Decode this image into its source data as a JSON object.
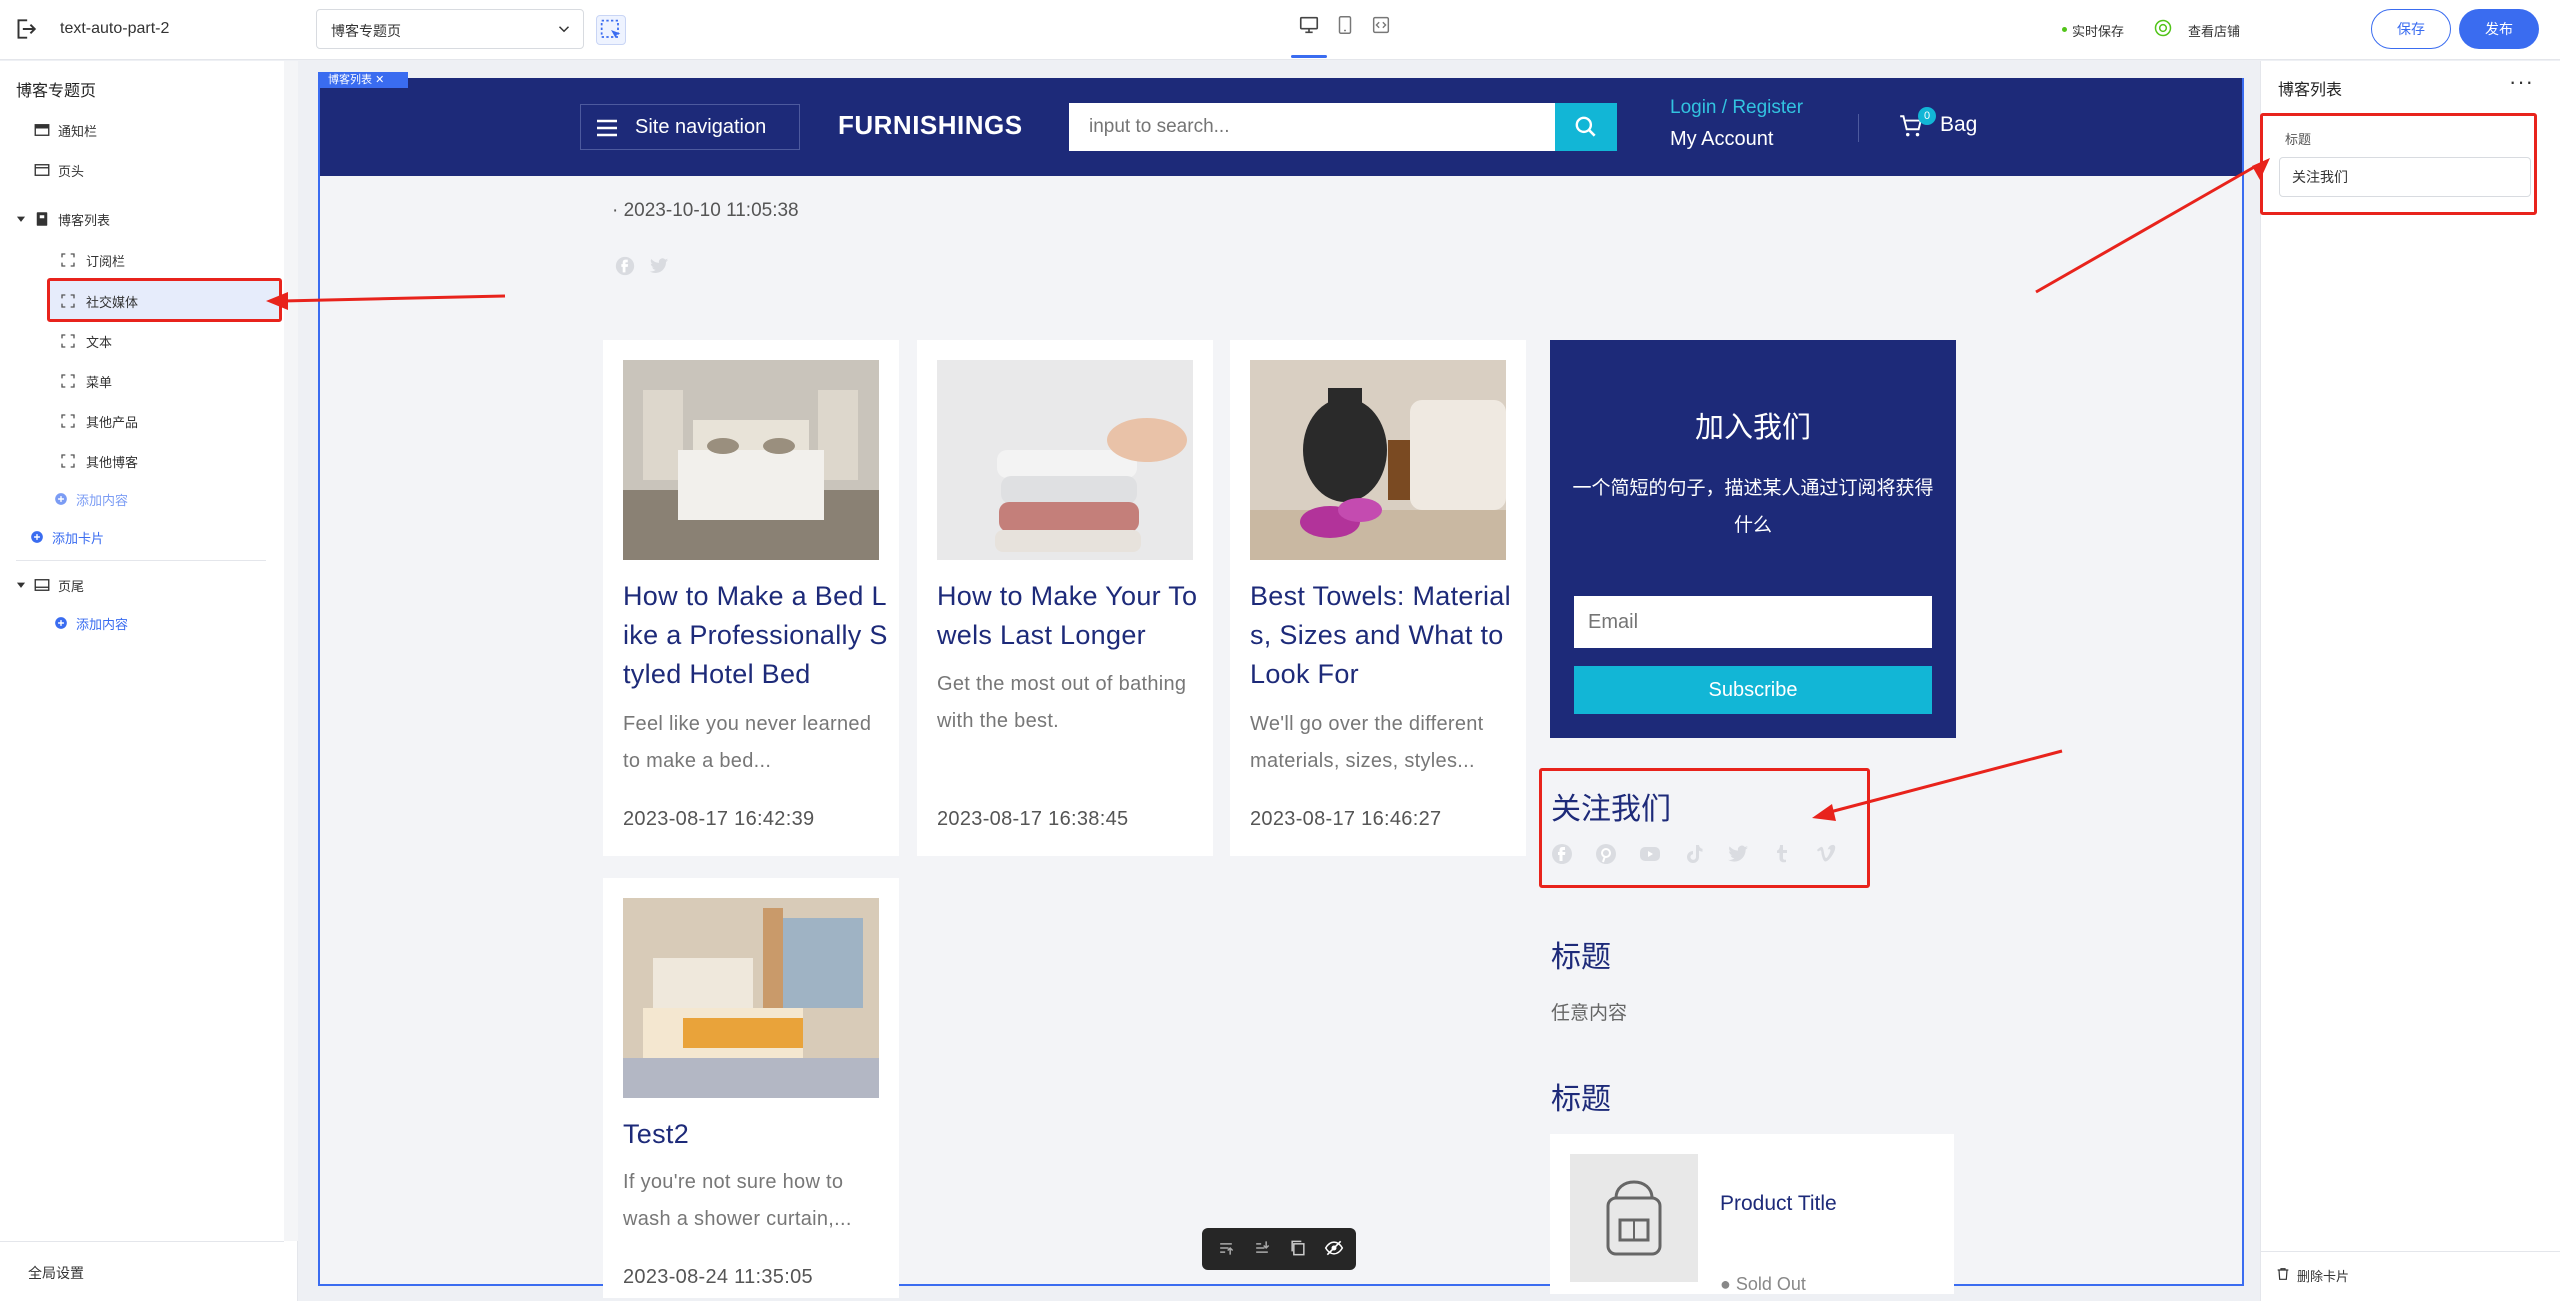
{
  "topbar": {
    "project_name": "text-auto-part-2",
    "page_select_value": "博客专题页",
    "autosave_label": "实时保存",
    "view_store_label": "查看店铺",
    "save_label": "保存",
    "publish_label": "发布"
  },
  "left_panel": {
    "title": "博客专题页",
    "items": [
      {
        "label": "通知栏"
      },
      {
        "label": "页头"
      },
      {
        "label": "博客列表"
      },
      {
        "label": "订阅栏"
      },
      {
        "label": "社交媒体"
      },
      {
        "label": "文本"
      },
      {
        "label": "菜单"
      },
      {
        "label": "其他产品"
      },
      {
        "label": "其他博客"
      },
      {
        "label": "添加内容"
      },
      {
        "label": "添加卡片"
      },
      {
        "label": "页尾"
      },
      {
        "label": "添加内容"
      }
    ],
    "global_settings": "全局设置"
  },
  "preview": {
    "section_tag": "博客列表",
    "header": {
      "site_nav": "Site navigation",
      "brand": "FURNISHINGS",
      "search_placeholder": "input to search...",
      "login": "Login / Register",
      "account": "My Account",
      "bag_count": "0",
      "bag": "Bag"
    },
    "post_date": "· 2023-10-10 11:05:38",
    "cards": [
      {
        "title": "How to Make a Bed Like a Professionally Styled Hotel Bed",
        "excerpt": "Feel like you never learned to make a bed...",
        "date": "2023-08-17 16:42:39"
      },
      {
        "title": "How to Make Your Towels Last Longer",
        "excerpt": "Get the most out of bathing with the best.",
        "date": "2023-08-17 16:38:45"
      },
      {
        "title": "Best Towels: Materials, Sizes and What to Look For",
        "excerpt": "We'll go over the different materials, sizes, styles...",
        "date": "2023-08-17 16:46:27"
      },
      {
        "title": "Test2",
        "excerpt": "If you're not sure how to wash a shower curtain,...",
        "date": "2023-08-24 11:35:05"
      }
    ],
    "join": {
      "title": "加入我们",
      "desc": "一个简短的句子，描述某人通过订阅将获得什么",
      "email_placeholder": "Email",
      "subscribe": "Subscribe"
    },
    "follow_title": "关注我们",
    "social_icons": [
      "facebook-icon",
      "pinterest-icon",
      "youtube-icon",
      "tiktok-icon",
      "twitter-icon",
      "tumblr-icon",
      "vimeo-icon"
    ],
    "text_block": {
      "title": "标题",
      "body": "任意内容"
    },
    "menu_block": {
      "title": "标题"
    },
    "product": {
      "title": "Product Title",
      "status": "Sold Out"
    }
  },
  "right_panel": {
    "title": "博客列表",
    "field_label": "标题",
    "field_value": "关注我们",
    "delete_card": "删除卡片"
  },
  "colors": {
    "accent": "#3a6cf0",
    "store_navy": "#1d2a79",
    "store_cyan": "#12b6d6",
    "annotation_red": "#e8231c"
  }
}
